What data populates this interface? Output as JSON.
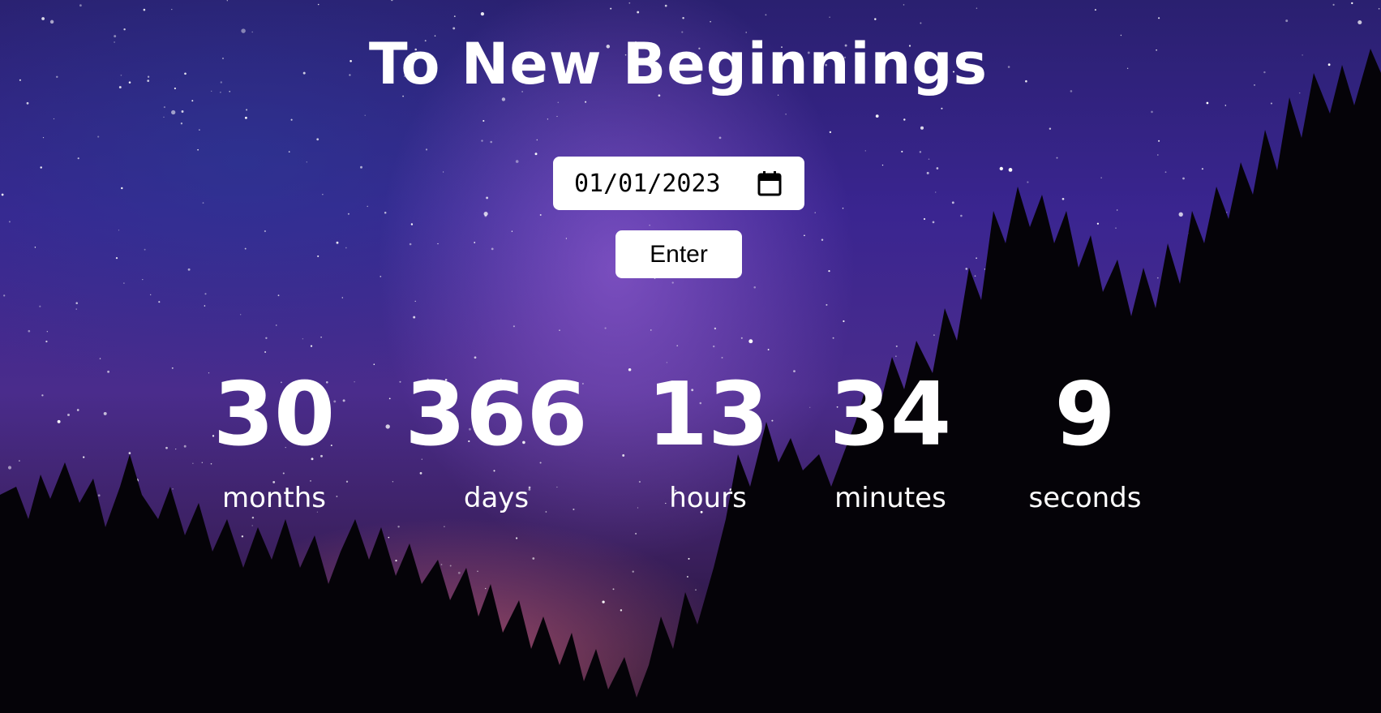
{
  "page": {
    "title": "To New Beginnings"
  },
  "date_input": {
    "value": "01/01/2023",
    "icon": "calendar-icon"
  },
  "enter_button": {
    "label": "Enter"
  },
  "countdown": [
    {
      "value": "30",
      "label": "months"
    },
    {
      "value": "366",
      "label": "days"
    },
    {
      "value": "13",
      "label": "hours"
    },
    {
      "value": "34",
      "label": "minutes"
    },
    {
      "value": "9",
      "label": "seconds"
    }
  ],
  "colors": {
    "text": "#ffffff",
    "control_background": "#ffffff",
    "control_text": "#000000"
  }
}
